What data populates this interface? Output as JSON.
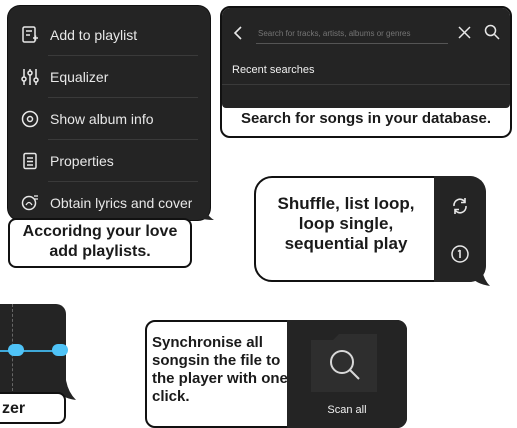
{
  "menu": {
    "items": [
      {
        "label": "Add to playlist",
        "icon": "playlist-add-icon"
      },
      {
        "label": "Equalizer",
        "icon": "equalizer-icon"
      },
      {
        "label": "Show album info",
        "icon": "album-icon"
      },
      {
        "label": "Properties",
        "icon": "properties-icon"
      },
      {
        "label": "Obtain lyrics and cover",
        "icon": "lyrics-icon"
      }
    ],
    "caption": "Accoridng your love add playlists."
  },
  "search": {
    "placeholder": "Search for tracks, artists, albums or genres",
    "recent_label": "Recent searches",
    "caption": "Search for songs in your database."
  },
  "playmode": {
    "text": "Shuffle, list loop, loop single, sequential play",
    "icons": [
      "repeat-icon",
      "sequential-icon"
    ]
  },
  "equalizer": {
    "caption": "zer"
  },
  "scan": {
    "text": "Synchronise all songsin the file to the player with one click.",
    "button_label": "Scan all"
  }
}
